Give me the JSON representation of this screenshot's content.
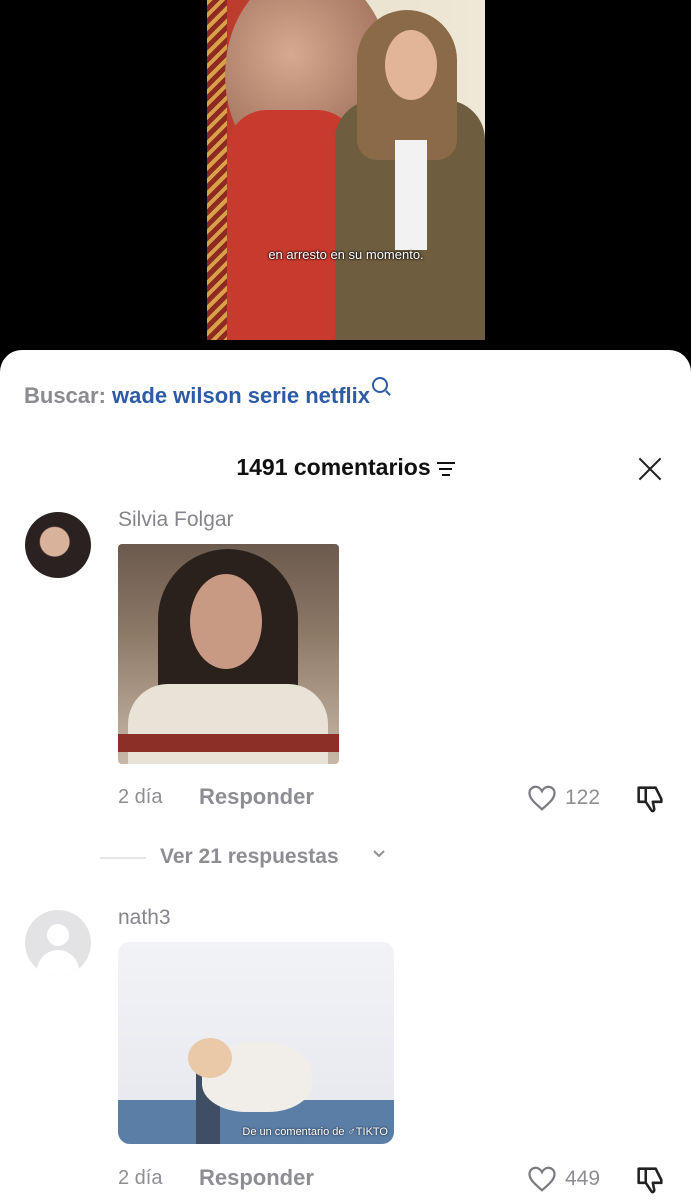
{
  "video": {
    "subtitle": "en arresto en su momento."
  },
  "search": {
    "prefix": "Buscar:",
    "query": "wade wilson serie netflix"
  },
  "header": {
    "count_label": "1491 comentarios"
  },
  "comments": [
    {
      "username": "Silvia Folgar",
      "time": "2 día",
      "reply_label": "Responder",
      "likes": "122",
      "replies_label": "Ver 21 respuestas"
    },
    {
      "username": "nath3",
      "time": "2 día",
      "reply_label": "Responder",
      "likes": "449",
      "media_caption": "De un comentario de ♂TIKTO"
    }
  ],
  "colors": {
    "link": "#2d5ba6",
    "muted": "#8d8e94",
    "text": "#111111"
  }
}
